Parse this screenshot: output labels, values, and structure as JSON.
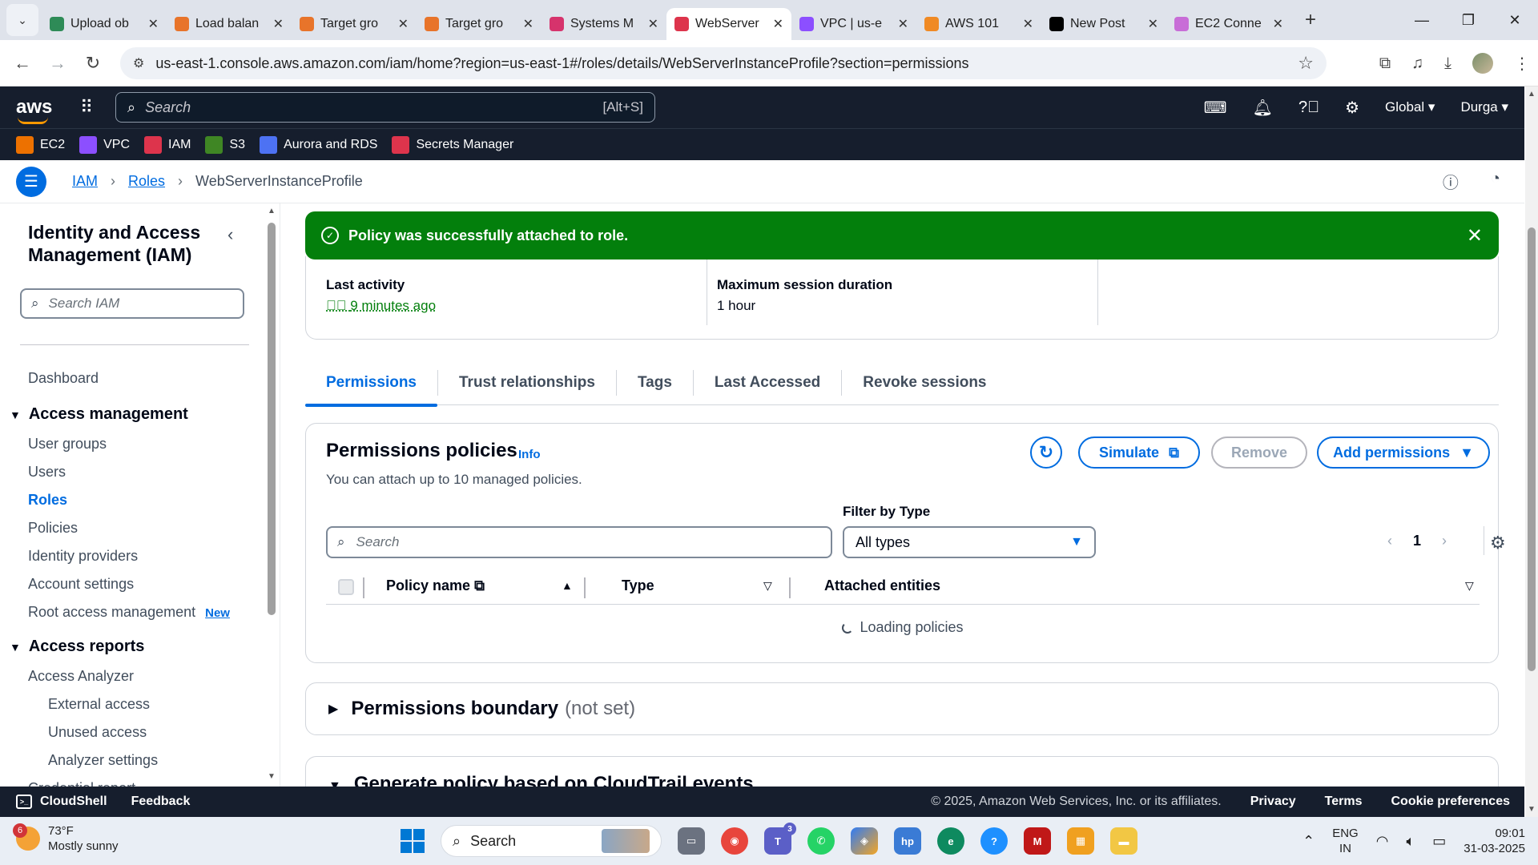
{
  "browser": {
    "tabs": [
      {
        "title": "Upload ob",
        "color": "#2e8b57",
        "active": false
      },
      {
        "title": "Load balan",
        "color": "#e8742a",
        "active": false
      },
      {
        "title": "Target gro",
        "color": "#e8742a",
        "active": false
      },
      {
        "title": "Target gro",
        "color": "#e8742a",
        "active": false
      },
      {
        "title": "Systems M",
        "color": "#d6336c",
        "active": false
      },
      {
        "title": "WebServer",
        "color": "#dd344c",
        "active": true
      },
      {
        "title": "VPC | us-e",
        "color": "#8c4fff",
        "active": false
      },
      {
        "title": "AWS 101",
        "color": "#f08a24",
        "active": false
      },
      {
        "title": "New Post",
        "color": "#000000",
        "active": false
      },
      {
        "title": "EC2 Conne",
        "color": "#c86dd7",
        "active": false
      }
    ],
    "new_tab": "+",
    "url": "us-east-1.console.aws.amazon.com/iam/home?region=us-east-1#/roles/details/WebServerInstanceProfile?section=permissions"
  },
  "aws_nav": {
    "logo": "aws",
    "search_placeholder": "Search",
    "search_shortcut": "[Alt+S]",
    "region": "Global ▾",
    "user": "Durga ▾",
    "favorites": [
      {
        "label": "EC2",
        "color": "#ed7100"
      },
      {
        "label": "VPC",
        "color": "#8c4fff"
      },
      {
        "label": "IAM",
        "color": "#dd344c"
      },
      {
        "label": "S3",
        "color": "#3f8624"
      },
      {
        "label": "Aurora and RDS",
        "color": "#4d72f3"
      },
      {
        "label": "Secrets Manager",
        "color": "#dd344c"
      }
    ]
  },
  "breadcrumb": {
    "iam": "IAM",
    "roles": "Roles",
    "current": "WebServerInstanceProfile"
  },
  "sidebar": {
    "title": "Identity and Access Management (IAM)",
    "search_placeholder": "Search IAM",
    "dashboard": "Dashboard",
    "access_management": "Access management",
    "user_groups": "User groups",
    "users": "Users",
    "roles": "Roles",
    "policies": "Policies",
    "identity_providers": "Identity providers",
    "account_settings": "Account settings",
    "root_access": "Root access management",
    "new_badge": "New",
    "access_reports": "Access reports",
    "access_analyzer": "Access Analyzer",
    "external_access": "External access",
    "unused_access": "Unused access",
    "analyzer_settings": "Analyzer settings",
    "credential_report": "Credential report"
  },
  "flash": {
    "message": "Policy was successfully attached to role."
  },
  "summary": {
    "last_activity_label": "Last activity",
    "last_activity_value": "9 minutes ago",
    "max_session_label": "Maximum session duration",
    "max_session_value": "1 hour"
  },
  "tabs": {
    "permissions": "Permissions",
    "trust": "Trust relationships",
    "tags": "Tags",
    "last_accessed": "Last Accessed",
    "revoke": "Revoke sessions"
  },
  "permissions": {
    "title": "Permissions policies",
    "info": "Info",
    "subtitle": "You can attach up to 10 managed policies.",
    "simulate": "Simulate",
    "remove": "Remove",
    "add": "Add permissions",
    "filter_label": "Filter by Type",
    "search_placeholder": "Search",
    "filter_value": "All types",
    "page": "1",
    "col_policy": "Policy name",
    "col_type": "Type",
    "col_entities": "Attached entities",
    "loading": "Loading policies"
  },
  "boundary": {
    "title": "Permissions boundary",
    "status": "(not set)"
  },
  "cloudtrail": {
    "title": "Generate policy based on CloudTrail events"
  },
  "footer": {
    "cloudshell": "CloudShell",
    "feedback": "Feedback",
    "copyright": "© 2025, Amazon Web Services, Inc. or its affiliates.",
    "privacy": "Privacy",
    "terms": "Terms",
    "cookies": "Cookie preferences"
  },
  "taskbar": {
    "weather_badge": "6",
    "temp": "73°F",
    "condition": "Mostly sunny",
    "search": "Search",
    "teams_count": "3",
    "lang1": "ENG",
    "lang2": "IN",
    "time": "09:01",
    "date": "31-03-2025"
  }
}
